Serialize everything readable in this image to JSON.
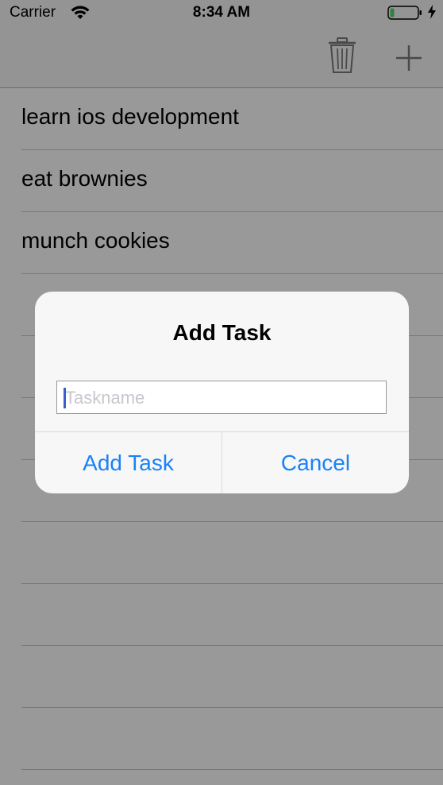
{
  "status_bar": {
    "carrier": "Carrier",
    "time": "8:34 AM",
    "wifi_icon": "wifi-icon",
    "battery_icon": "battery-icon",
    "battery_level": 0.15,
    "charging_icon": "bolt-icon"
  },
  "nav_bar": {
    "trash_icon": "trash-icon",
    "add_icon": "plus-icon",
    "tint_color": "#9e9e9e"
  },
  "tasks": [
    {
      "label": "learn ios development"
    },
    {
      "label": "eat brownies"
    },
    {
      "label": "munch cookies"
    },
    {
      "label": ""
    },
    {
      "label": ""
    },
    {
      "label": ""
    },
    {
      "label": ""
    },
    {
      "label": ""
    },
    {
      "label": ""
    },
    {
      "label": ""
    },
    {
      "label": ""
    }
  ],
  "alert": {
    "title": "Add Task",
    "input_placeholder": "Taskname",
    "input_value": "",
    "confirm_label": "Add Task",
    "cancel_label": "Cancel",
    "accent_color": "#1a82f7"
  }
}
